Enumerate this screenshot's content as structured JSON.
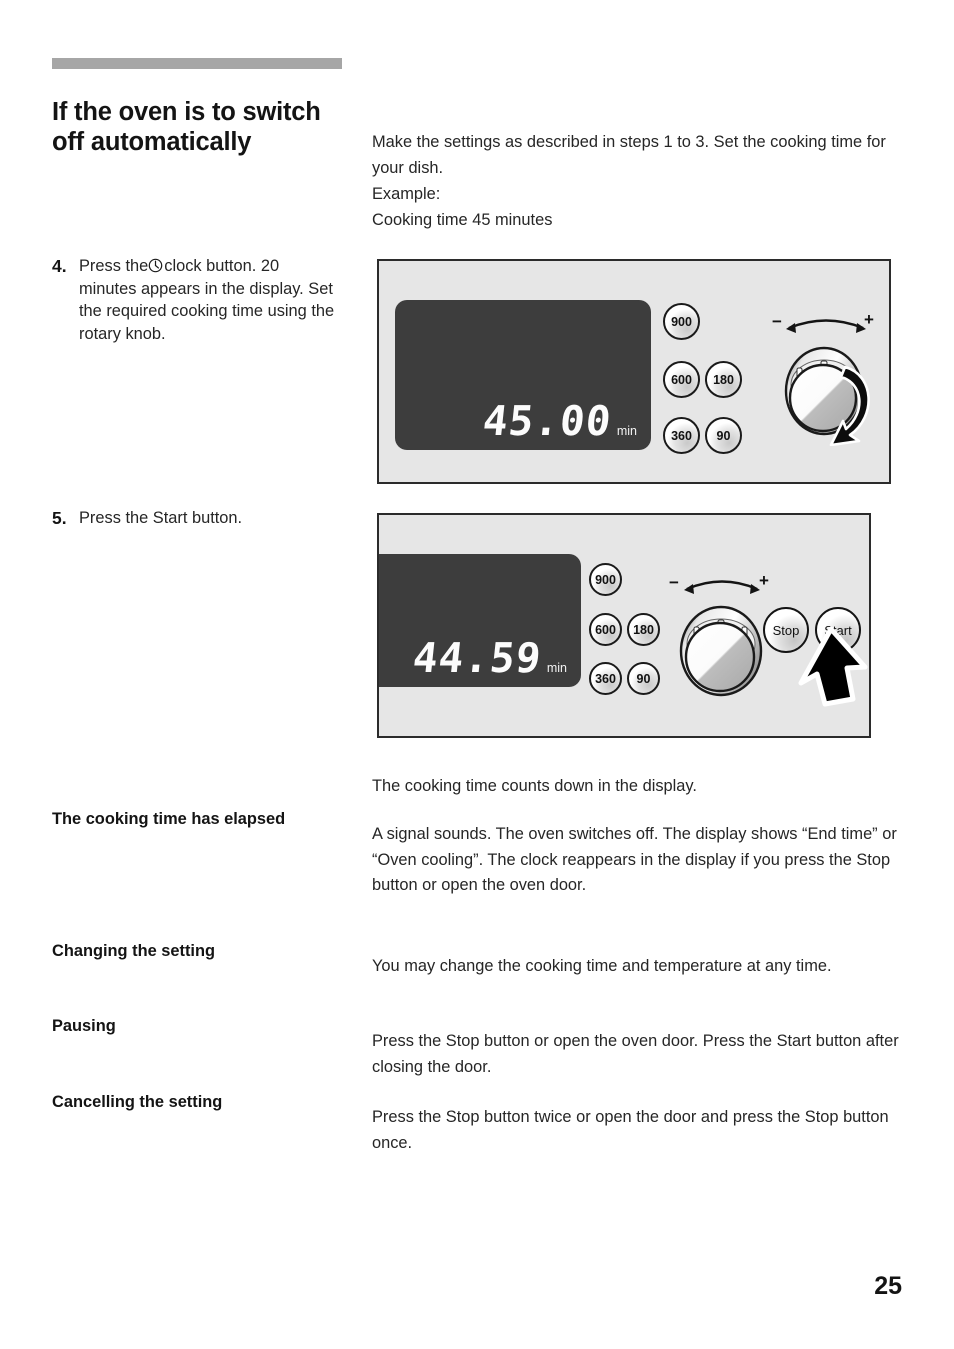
{
  "page": {
    "title": "If the oven is to switch off automatically",
    "number": "25"
  },
  "intro": {
    "paragraph_1": "Make the settings as described in steps 1 to 3. Set the cooking time for your dish.",
    "paragraph_2_line_1": "Example:",
    "paragraph_2_line_2": "Cooking time 45 minutes"
  },
  "steps": [
    {
      "number": "4.",
      "text_before_icon": "Press the",
      "icon": "clock-icon",
      "text_after_icon": "clock button. 20 minutes appears in the display. Set the required cooking time using the rotary knob."
    },
    {
      "number": "5.",
      "text": "Press the Start button."
    }
  ],
  "figures": [
    {
      "name": "oven-control-panel-setting-time",
      "display_value": "45.00",
      "display_unit": "min",
      "power_buttons": [
        "900",
        "600",
        "180",
        "360",
        "90"
      ],
      "knob": {
        "minus_label": "−",
        "plus_label": "+",
        "rotation_arrow": "clockwise"
      },
      "action_buttons": []
    },
    {
      "name": "oven-control-panel-counting-down",
      "display_value": "44.59",
      "display_unit": "min",
      "power_buttons": [
        "900",
        "600",
        "180",
        "360",
        "90"
      ],
      "knob": {
        "minus_label": "−",
        "plus_label": "+",
        "rotation_arrow": "none"
      },
      "action_buttons": [
        "Stop",
        "Start"
      ],
      "cursor_points_at": "Start"
    }
  ],
  "caption": "The cooking time counts down in the display.",
  "definitions": [
    {
      "term": "The cooking time has elapsed",
      "description": "A signal sounds. The oven switches off. The display shows “End time” or “Oven cooling”. The clock reappears in the display if you press the Stop button or open the oven door."
    },
    {
      "term": "Changing the setting",
      "description": "You may change the cooking time and temperature at any time."
    },
    {
      "term": "Pausing",
      "description": "Press the Stop button or open the oven door. Press the Start button after closing the door."
    },
    {
      "term": "Cancelling the setting",
      "description": "Press the Stop button twice or open the door and press the Stop button once."
    }
  ],
  "colors": {
    "rule_bar": "#a6a6a6",
    "panel_background": "#e6e6e6",
    "display_background": "#3d3d3d",
    "display_text": "#fcfcfc"
  }
}
